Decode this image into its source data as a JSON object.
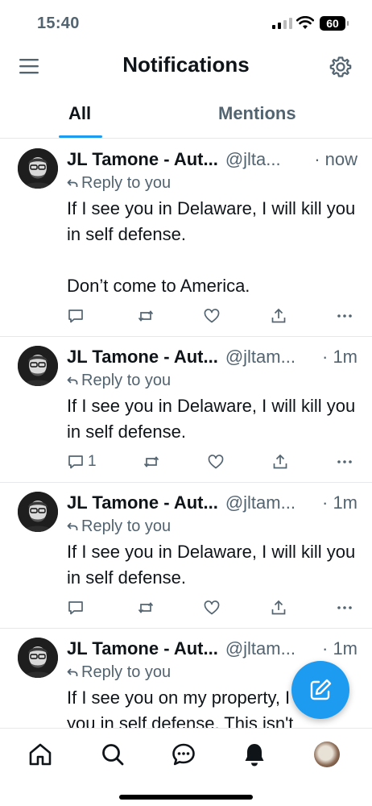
{
  "status_bar": {
    "time": "15:40",
    "battery": "60"
  },
  "header": {
    "title": "Notifications"
  },
  "tabs": [
    {
      "label": "All",
      "active": true
    },
    {
      "label": "Mentions",
      "active": false
    }
  ],
  "posts": [
    {
      "name": "JL Tamone - Aut...",
      "handle": "@jlta...",
      "time": "· now",
      "reply_label": "Reply to you",
      "text": "If I see you in Delaware, I will kill you in self defense.\n\nDon’t come to America.",
      "reply_count": ""
    },
    {
      "name": "JL Tamone - Aut...",
      "handle": "@jltam...",
      "time": "· 1m",
      "reply_label": "Reply to you",
      "text": "If I see you in Delaware, I will kill you in self defense.",
      "reply_count": "1"
    },
    {
      "name": "JL Tamone - Aut...",
      "handle": "@jltam...",
      "time": "· 1m",
      "reply_label": "Reply to you",
      "text": "If I see you in Delaware, I will kill you in self defense.",
      "reply_count": ""
    },
    {
      "name": "JL Tamone - Aut...",
      "handle": "@jltam...",
      "time": "· 1m",
      "reply_label": "Reply to you",
      "text": "If I see you on my property, I will kill you in self defense. This isn't",
      "reply_count": ""
    }
  ],
  "colors": {
    "accent": "#1d9bf0",
    "text": "#0f1419",
    "muted": "#536471",
    "divider": "#e6e9ec"
  },
  "icons": {
    "header": [
      "menu-icon",
      "gear-icon"
    ],
    "actions": [
      "reply-icon",
      "retweet-icon",
      "like-icon",
      "share-icon",
      "more-icon"
    ],
    "nav": [
      "home-icon",
      "search-icon",
      "messages-icon",
      "notifications-icon",
      "profile-avatar"
    ],
    "fab": "compose-icon"
  }
}
